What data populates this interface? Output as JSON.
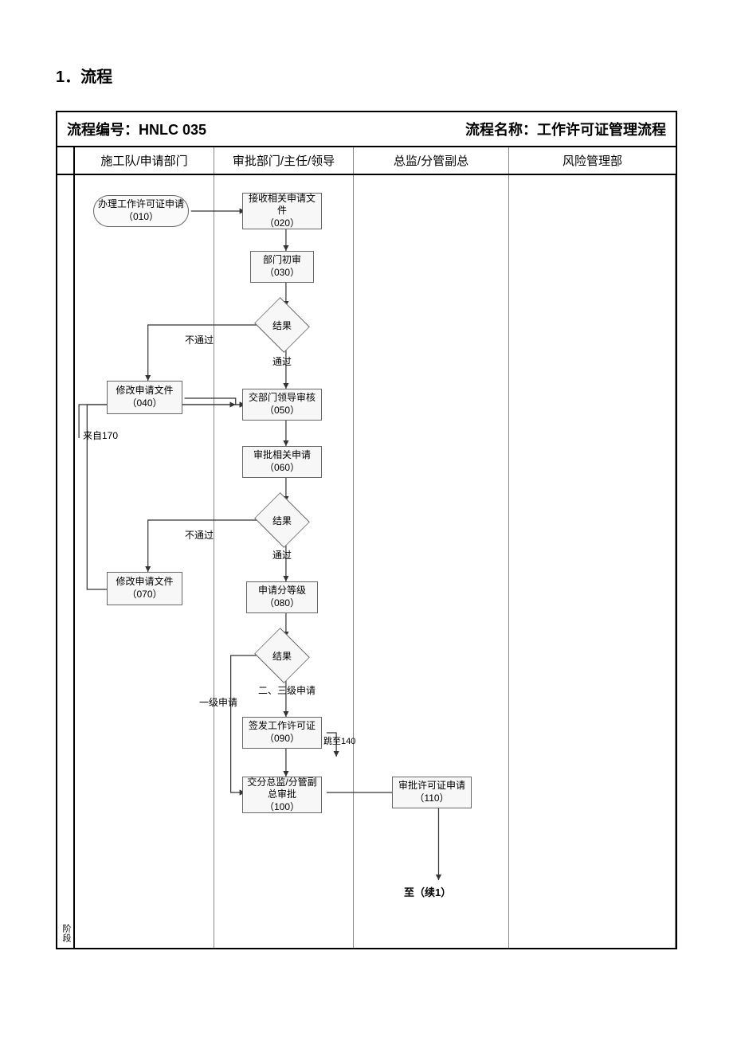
{
  "section_title": "1．流程",
  "header": {
    "id_label": "流程编号：",
    "id_value": "HNLC 035",
    "name_label": "流程名称：",
    "name_value": "工作许可证管理流程"
  },
  "lanes": {
    "phase": "阶段",
    "l1": "施工队/申请部门",
    "l2": "审批部门/主任/领导",
    "l3": "总监/分管副总",
    "l4": "风险管理部"
  },
  "nodes": {
    "n010": {
      "title": "办理工作许可证申请",
      "code": "（010）"
    },
    "n020": {
      "title": "接收相关申请文件",
      "code": "（020）"
    },
    "n030": {
      "title": "部门初审",
      "code": "（030）"
    },
    "d1": {
      "label": "结果"
    },
    "n040": {
      "title": "修改申请文件",
      "code": "（040）"
    },
    "n050": {
      "title": "交部门领导审核",
      "code": "（050）"
    },
    "n060": {
      "title": "审批相关申请",
      "code": "（060）"
    },
    "d2": {
      "label": "结果"
    },
    "n070": {
      "title": "修改申请文件",
      "code": "（070）"
    },
    "n080": {
      "title": "申请分等级",
      "code": "（080）"
    },
    "d3": {
      "label": "结果"
    },
    "n090": {
      "title": "签发工作许可证",
      "code": "（090）"
    },
    "n100": {
      "title": "交分总监/分管副总审批",
      "code": "（100）"
    },
    "n110": {
      "title": "审批许可证申请",
      "code": "（110）"
    }
  },
  "edge_labels": {
    "pass1": "通过",
    "fail1": "不通过",
    "pass2": "通过",
    "fail2": "不通过",
    "lvl23": "二、三级申请",
    "lvl1": "一级申请",
    "from170": "来自170",
    "to140": "跳至140",
    "to_cont": "至（续1）"
  }
}
